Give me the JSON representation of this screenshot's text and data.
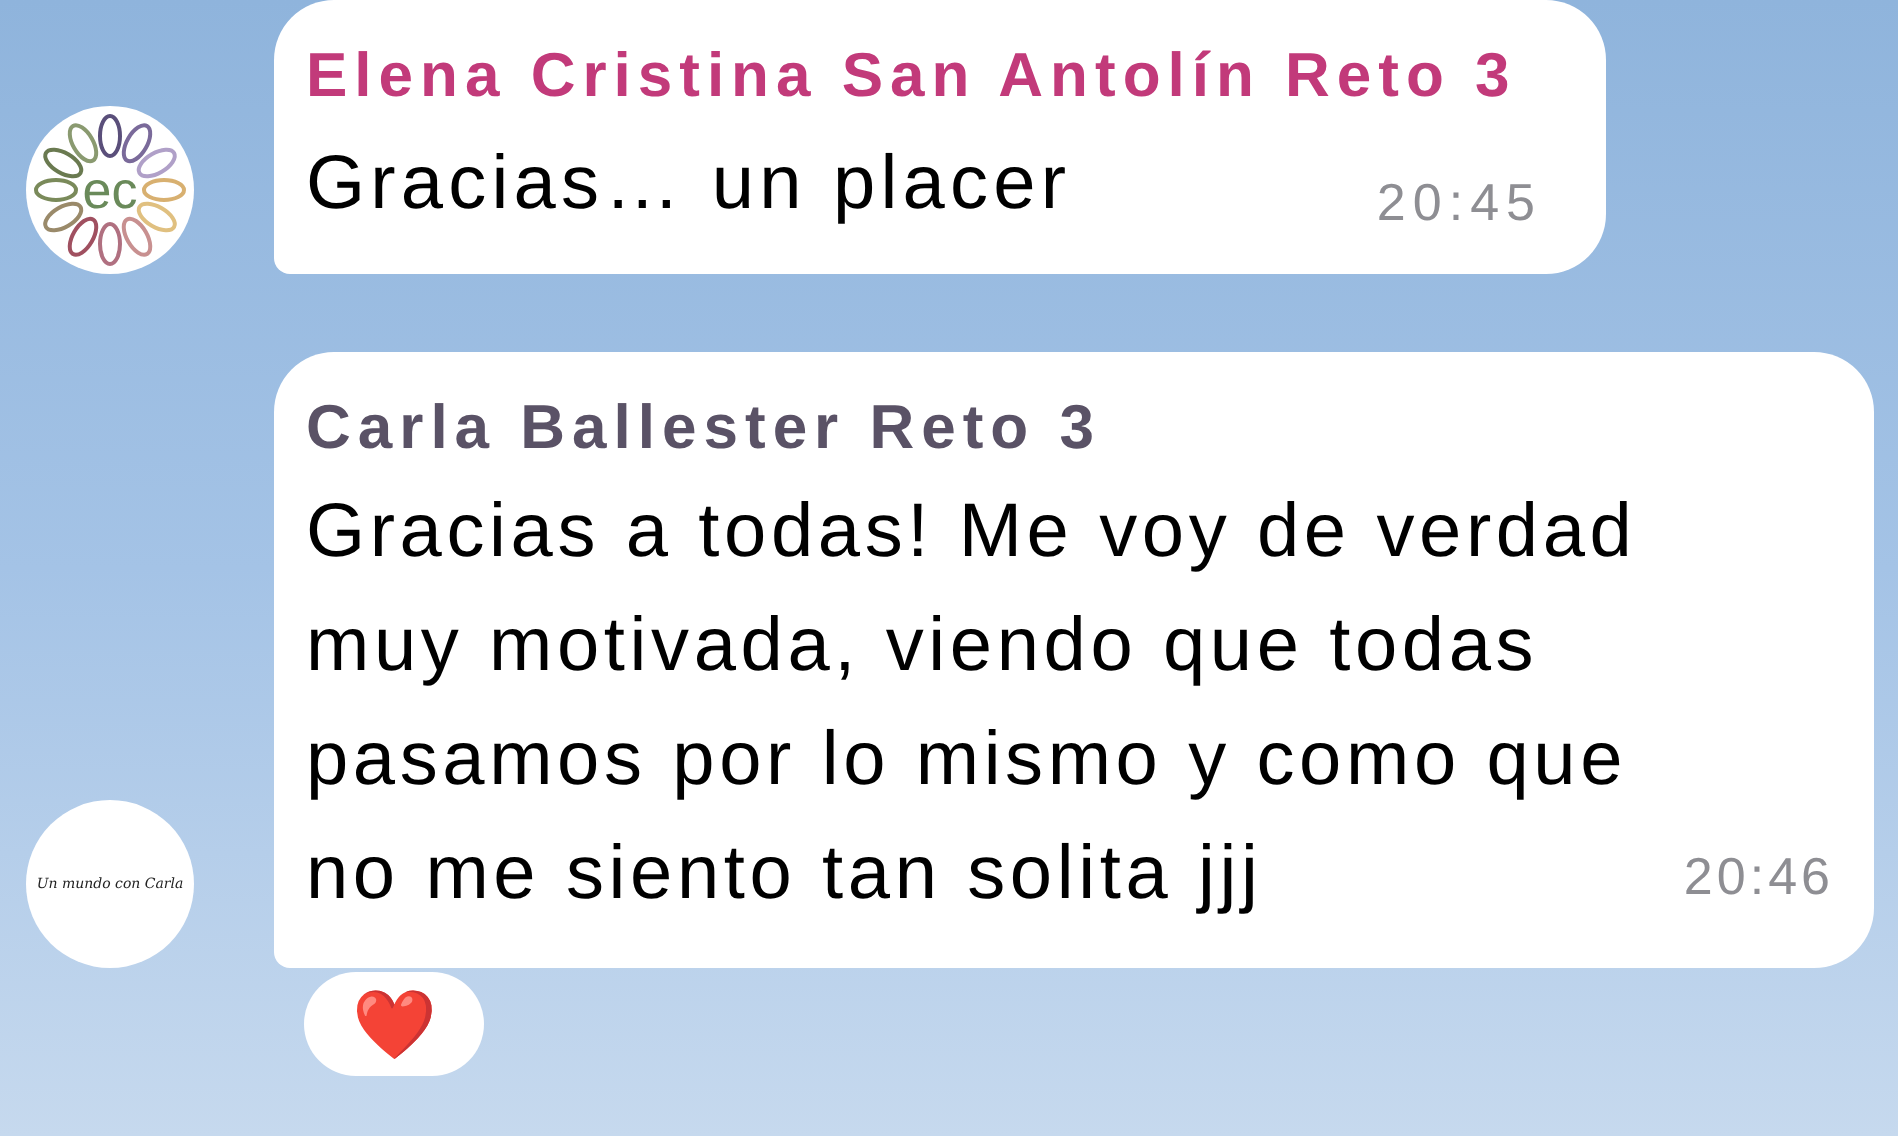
{
  "messages": [
    {
      "sender": "Elena Cristina San Antolín Reto 3",
      "color": "#c23a7a",
      "avatar_text": "ec",
      "text": "Gracias… un placer",
      "time": "20:45"
    },
    {
      "sender": "Carla Ballester Reto 3",
      "color": "#5a5266",
      "avatar_text": "Un mundo con Carla",
      "text": "Gracias a todas! Me voy de verdad muy motivada, viendo que todas pasamos por lo mismo y como que no me siento tan solita jjj",
      "time": "20:46",
      "reactions": [
        "❤️"
      ]
    }
  ]
}
